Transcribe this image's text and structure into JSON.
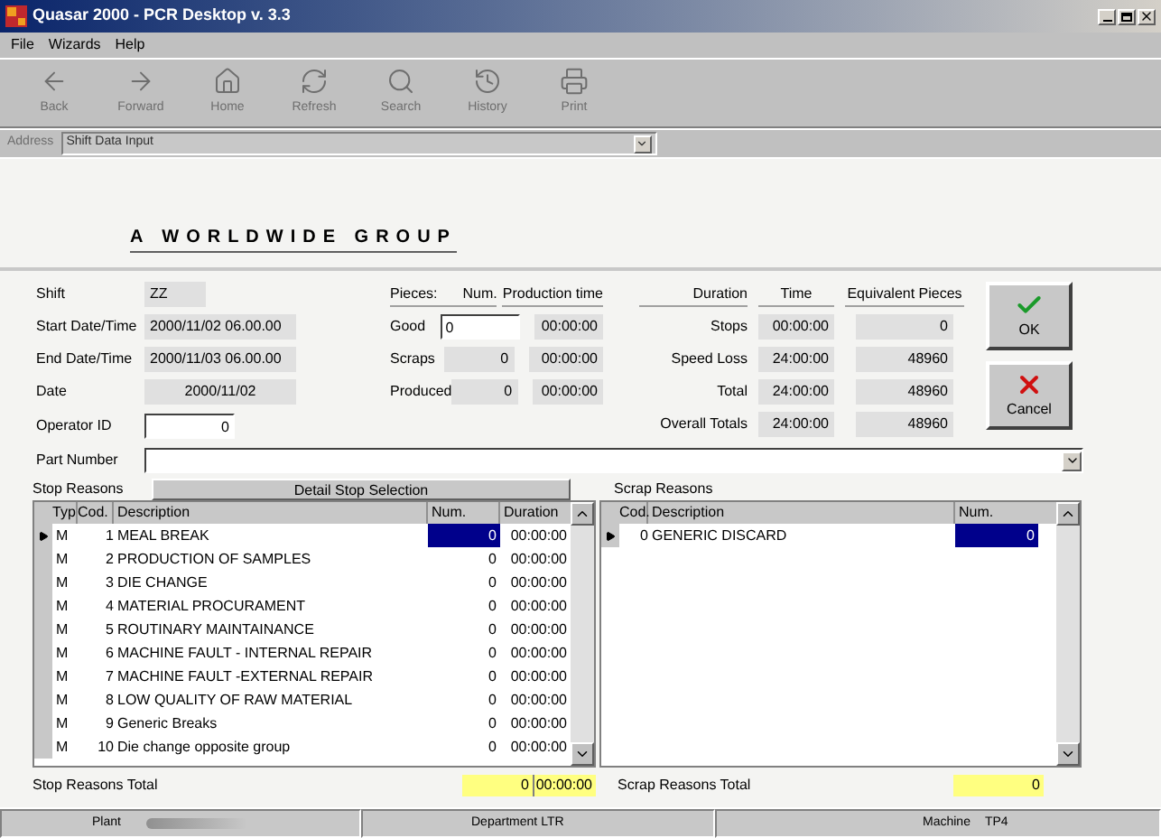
{
  "window": {
    "title": "Quasar 2000 - PCR Desktop v. 3.3"
  },
  "menu": [
    "File",
    "Wizards",
    "Help"
  ],
  "toolbar": [
    {
      "label": "Back",
      "disabled": true
    },
    {
      "label": "Forward",
      "disabled": true
    },
    {
      "label": "Home",
      "disabled": true
    },
    {
      "label": "Refresh",
      "disabled": true
    },
    {
      "label": "Search",
      "disabled": true
    },
    {
      "label": "History",
      "disabled": true
    },
    {
      "label": "Print",
      "disabled": true
    }
  ],
  "address": {
    "label": "Address",
    "value": "Shift Data Input"
  },
  "banner": "A WORLDWIDE GROUP",
  "shift_info": [
    {
      "label": "Shift",
      "value": "ZZ"
    },
    {
      "label": "Start Date/Time",
      "value": "2000/11/02 06.00.00"
    },
    {
      "label": "End Date/Time",
      "value": "2000/11/03 06.00.00"
    },
    {
      "label": "Date",
      "value": "2000/11/02"
    }
  ],
  "operator_id": {
    "label": "Operator ID",
    "value": "0"
  },
  "pieces": {
    "header": "Pieces:",
    "num_header": "Num.",
    "time_header": "Production time",
    "rows": [
      {
        "label": "Good",
        "num": "0",
        "time": "00:00:00",
        "kind": "input"
      },
      {
        "label": "Scraps",
        "num": "0",
        "time": "00:00:00",
        "kind": "readonly"
      },
      {
        "label": "Produced",
        "num": "0",
        "time": "00:00:00",
        "kind": "readonly"
      }
    ]
  },
  "durations": {
    "header": "Duration",
    "time_header": "Time",
    "equiv_header": "Equivalent Pieces",
    "rows": [
      {
        "label": "Stops",
        "time": "00:00:00",
        "equiv": "0"
      },
      {
        "label": "Speed Loss",
        "time": "24:00:00",
        "equiv": "48960"
      },
      {
        "label": "Total",
        "time": "24:00:00",
        "equiv": "48960"
      },
      {
        "label": "Overall Totals",
        "time": "24:00:00",
        "equiv": "48960"
      }
    ]
  },
  "buttons": [
    {
      "label": "OK",
      "kind": "confirm"
    },
    {
      "label": "Cancel",
      "kind": "cancel"
    }
  ],
  "part_number": {
    "label": "Part Number"
  },
  "stop_reasons": {
    "title": "Stop Reasons",
    "detail_button": "Detail Stop Selection",
    "columns": [
      "Typ",
      "Cod.",
      "Description",
      "Num.",
      "Duration"
    ],
    "rows": [
      {
        "typ": "M",
        "cod": "1",
        "description": "MEAL BREAK",
        "num": "0",
        "duration": "00:00:00",
        "selected": true
      },
      {
        "typ": "M",
        "cod": "2",
        "description": "PRODUCTION OF SAMPLES",
        "num": "0",
        "duration": "00:00:00",
        "selected": false
      },
      {
        "typ": "M",
        "cod": "3",
        "description": "DIE CHANGE",
        "num": "0",
        "duration": "00:00:00",
        "selected": false
      },
      {
        "typ": "M",
        "cod": "4",
        "description": "MATERIAL PROCURAMENT",
        "num": "0",
        "duration": "00:00:00",
        "selected": false
      },
      {
        "typ": "M",
        "cod": "5",
        "description": "ROUTINARY MAINTAINANCE",
        "num": "0",
        "duration": "00:00:00",
        "selected": false
      },
      {
        "typ": "M",
        "cod": "6",
        "description": "MACHINE FAULT - INTERNAL REPAIR",
        "num": "0",
        "duration": "00:00:00",
        "selected": false
      },
      {
        "typ": "M",
        "cod": "7",
        "description": "MACHINE FAULT -EXTERNAL REPAIR",
        "num": "0",
        "duration": "00:00:00",
        "selected": false
      },
      {
        "typ": "M",
        "cod": "8",
        "description": "LOW QUALITY OF RAW MATERIAL",
        "num": "0",
        "duration": "00:00:00",
        "selected": false
      },
      {
        "typ": "M",
        "cod": "9",
        "description": "Generic Breaks",
        "num": "0",
        "duration": "00:00:00",
        "selected": false
      },
      {
        "typ": "M",
        "cod": "10",
        "description": "Die change opposite group",
        "num": "0",
        "duration": "00:00:00",
        "selected": false
      }
    ],
    "total_label": "Stop Reasons Total",
    "total_num": "0",
    "total_duration": "00:00:00"
  },
  "scrap_reasons": {
    "title": "Scrap Reasons",
    "columns": [
      "Cod.",
      "Description",
      "Num."
    ],
    "rows": [
      {
        "cod": "0",
        "description": "GENERIC DISCARD",
        "num": "0",
        "selected": true
      }
    ],
    "total_label": "Scrap Reasons Total",
    "total_num": "0"
  },
  "status_bar": {
    "plant_label": "Plant",
    "department_label": "Department",
    "department": "LTR",
    "machine_label": "Machine",
    "machine": "TP4"
  }
}
